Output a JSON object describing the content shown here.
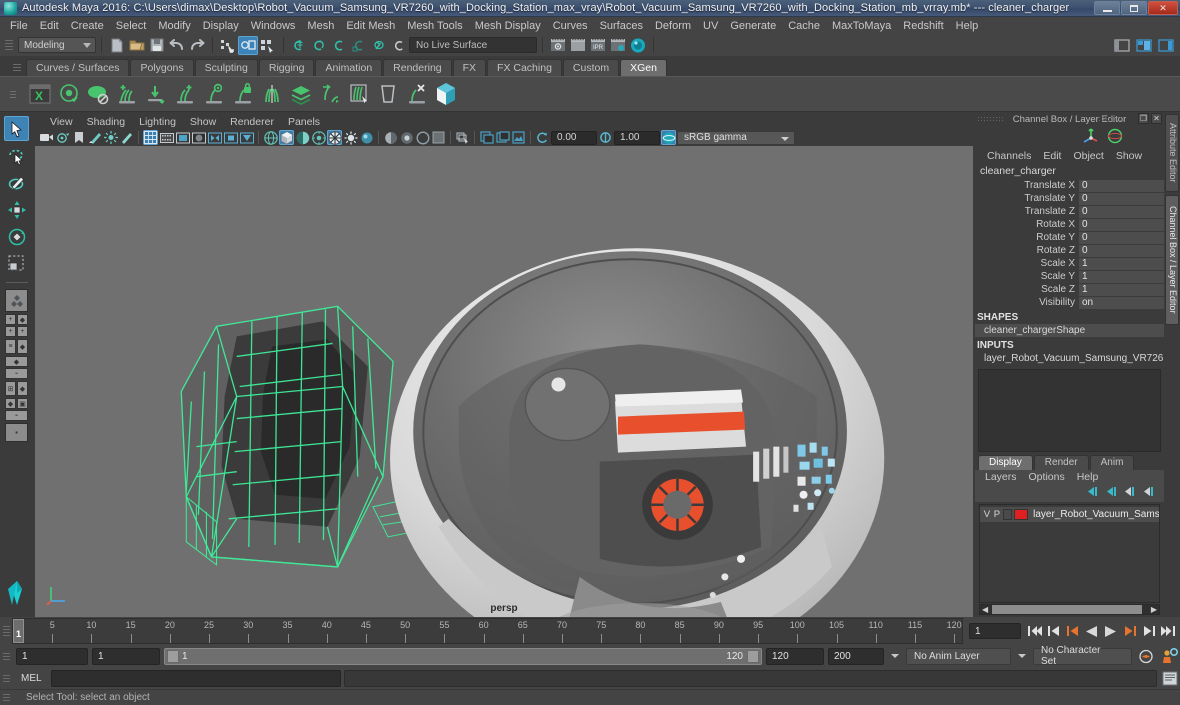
{
  "window": {
    "title": "Autodesk Maya 2016: C:\\Users\\dimax\\Desktop\\Robot_Vacuum_Samsung_VR7260_with_Docking_Station_max_vray\\Robot_Vacuum_Samsung_VR7260_with_Docking_Station_mb_vrray.mb*  ---  cleaner_charger",
    "minimize": "–",
    "maximize": "❐",
    "close": "✕"
  },
  "menubar": {
    "items": [
      "File",
      "Edit",
      "Create",
      "Select",
      "Modify",
      "Display",
      "Windows",
      "Mesh",
      "Edit Mesh",
      "Mesh Tools",
      "Mesh Display",
      "Curves",
      "Surfaces",
      "Deform",
      "UV",
      "Generate",
      "Cache",
      "MaxToMaya",
      "Redshift",
      "Help"
    ]
  },
  "toolbar": {
    "menuset_value": "Modeling",
    "live_surface_value": "No Live Surface",
    "icons": [
      "new-scene-icon",
      "open-scene-icon",
      "save-scene-icon",
      "undo-icon",
      "redo-icon",
      "select-by-hierarchy-icon",
      "select-by-object-type-icon",
      "select-by-component-type-icon",
      "snap-to-grid-icon",
      "snap-to-curve-icon",
      "snap-to-point-icon",
      "snap-to-projected-center-icon",
      "snap-to-view-plane-icon",
      "make-live-icon",
      "render-current-frame-icon",
      "ipr-render-icon",
      "render-settings-icon",
      "hypershade-icon",
      "render-view-icon"
    ],
    "right_icons": [
      "show-hide-ui-icon",
      "toggle-layout-icon",
      "sidebar-icon"
    ]
  },
  "shelf": {
    "tabs": [
      "Curves / Surfaces",
      "Polygons",
      "Sculpting",
      "Rigging",
      "Animation",
      "Rendering",
      "FX",
      "FX Caching",
      "Custom",
      "XGen"
    ],
    "active_tab": "XGen",
    "icons": [
      "xgen-editor-icon",
      "xgen-preview-icon",
      "xgen-disable-preview-icon",
      "xgen-add-clump-icon",
      "xgen-add-noise-icon",
      "xgen-grow-icon",
      "xgen-density-icon",
      "xgen-lock-icon",
      "xgen-part-icon",
      "xgen-layers-icon",
      "xgen-cut-icon",
      "xgen-comb-icon",
      "xgen-region-icon",
      "xgen-clear-icon",
      "xgen-node-icon"
    ]
  },
  "toolbox": {
    "items": [
      "select-tool",
      "lasso-select-tool",
      "paint-select-tool",
      "move-tool",
      "rotate-tool",
      "scale-tool",
      "last-tool",
      "single-perspective-layout",
      "four-view-layout",
      "persp-outliner-layout",
      "persp-graph-layout",
      "persp-hypershade-layout",
      "hypershade-persp-layout",
      "persp-uv-layout",
      "single-pane-layout",
      "maya-logo"
    ]
  },
  "viewport": {
    "menus": [
      "View",
      "Shading",
      "Lighting",
      "Show",
      "Renderer",
      "Panels"
    ],
    "camera_label": "persp",
    "exposure_value": "0.00",
    "gamma_value": "1.00",
    "color_space": "sRGB gamma",
    "tool_icons": [
      "select-camera-icon",
      "camera-attributes-icon",
      "bookmark-icon",
      "image-plane-icon",
      "two-sided-lighting-icon",
      "shadows-icon",
      "grid-icon",
      "film-gate-icon",
      "resolution-gate-icon",
      "gate-mask-icon",
      "exposure-icon",
      "xray-icon",
      "xray-joints-icon",
      "wireframe-icon",
      "smooth-shade-all-icon",
      "smooth-shade-textured-icon",
      "use-all-lights-icon",
      "shadows-toggle-icon",
      "ambient-occlusion-icon",
      "motion-blur-icon",
      "multisample-icon",
      "isolate-select-icon",
      "grid-display-icon",
      "image-plane-display-icon",
      "snapshot-icon"
    ]
  },
  "channelbox": {
    "panel_title": "Channel Box / Layer Editor",
    "menus": [
      "Channels",
      "Edit",
      "Object",
      "Show"
    ],
    "object_name": "cleaner_charger",
    "transform_rows": [
      {
        "label": "Translate X",
        "value": "0"
      },
      {
        "label": "Translate Y",
        "value": "0"
      },
      {
        "label": "Translate Z",
        "value": "0"
      },
      {
        "label": "Rotate X",
        "value": "0"
      },
      {
        "label": "Rotate Y",
        "value": "0"
      },
      {
        "label": "Rotate Z",
        "value": "0"
      },
      {
        "label": "Scale X",
        "value": "1"
      },
      {
        "label": "Scale Y",
        "value": "1"
      },
      {
        "label": "Scale Z",
        "value": "1"
      },
      {
        "label": "Visibility",
        "value": "on"
      }
    ],
    "shapes_title": "SHAPES",
    "shapes_item": "cleaner_chargerShape",
    "inputs_title": "INPUTS",
    "inputs_item": "layer_Robot_Vacuum_Samsung_VR726...",
    "vtabs": [
      "Attribute Editor",
      "Channel Box / Layer Editor"
    ]
  },
  "layereditor": {
    "tabs": [
      "Display",
      "Render",
      "Anim"
    ],
    "active_tab": "Display",
    "menus": [
      "Layers",
      "Options",
      "Help"
    ],
    "buttons": [
      "layer-prev-icon",
      "layer-prev-all-icon",
      "layer-next-icon",
      "layer-next-all-icon"
    ],
    "layers": [
      {
        "visible": "V",
        "playback": "P",
        "color": "#e02020",
        "name": "layer_Robot_Vacuum_Samsung"
      }
    ]
  },
  "timeline": {
    "current_frame": "1",
    "frame_field": "1",
    "tick_labels": [
      "5",
      "10",
      "15",
      "20",
      "25",
      "30",
      "35",
      "40",
      "45",
      "50",
      "55",
      "60",
      "65",
      "70",
      "75",
      "80",
      "85",
      "90",
      "95",
      "100",
      "105",
      "110",
      "115",
      "120"
    ],
    "playback_buttons": [
      "go-to-start-icon",
      "step-back-keyframe-icon",
      "step-back-frame-icon",
      "play-backwards-icon",
      "play-forwards-icon",
      "step-forward-frame-icon",
      "step-forward-keyframe-icon",
      "go-to-end-icon"
    ]
  },
  "rangeslider": {
    "anim_start": "1",
    "playback_start": "1",
    "range_start_label": "1",
    "range_end_label": "120",
    "playback_end": "120",
    "anim_end": "200",
    "anim_layer": "No Anim Layer",
    "character_set": "No Character Set",
    "auto_key_icon": "auto-keyframe-icon",
    "anim_prefs_icon": "animation-preferences-icon"
  },
  "commandline": {
    "label": "MEL",
    "input_value": "",
    "output_value": "",
    "script_editor_icon": "script-editor-icon"
  },
  "statusline": {
    "message": "Select Tool: select an object"
  },
  "colors": {
    "accent_blue": "#3b83b8",
    "xgen_green": "#4caf50",
    "layer_red": "#e02020",
    "viewport_bg": "#707070",
    "wireframe_green": "#3ef09a",
    "title_gradient_top": "#4b6079"
  }
}
